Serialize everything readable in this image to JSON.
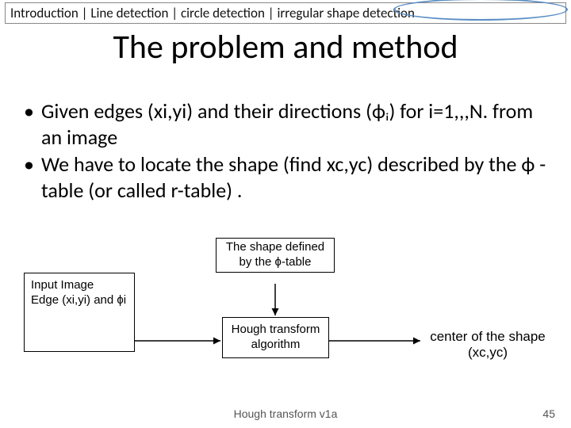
{
  "breadcrumb": {
    "items": [
      "Introduction",
      "Line detection",
      "circle detection",
      "irregular shape detection"
    ]
  },
  "title": "The problem and method",
  "bullets": [
    "Given edges (xi,yi) and their directions (ϕᵢ) for i=1,,,N. from an image",
    "We have to locate the shape (find xc,yc) described by the ϕ -table (or called r-table) ."
  ],
  "diagram": {
    "input_box": "Input Image\nEdge (xi,yi) and ϕi",
    "shape_box": "The shape defined by the ϕ-table",
    "algorithm_box": "Hough transform algorithm",
    "output_text": "center of the shape (xc,yc)"
  },
  "footer": {
    "left": "Hough transform v1a",
    "right": "45"
  }
}
